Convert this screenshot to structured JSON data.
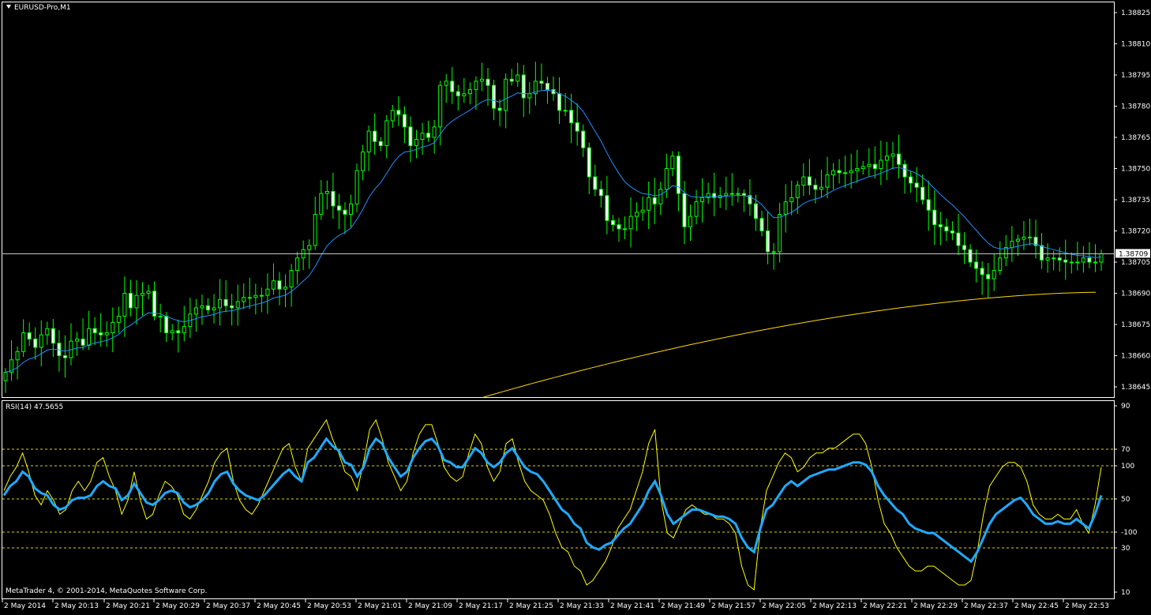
{
  "header": {
    "symbol_label": "EURUSD-Pro,M1"
  },
  "footer": {
    "copyright": "MetaTrader 4, © 2001-2014, MetaQuotes Software Corp."
  },
  "rsi_panel": {
    "label": "RSI(14) 47.5655"
  },
  "colors": {
    "background": "#000000",
    "frame": "#ffffff",
    "candle_bull": "#00ff00",
    "candle_bear_fill": "#ffffff",
    "ma_fast": "#1e90ff",
    "ma_slow": "#ffd700",
    "rsi_main": "#1eaaff",
    "rsi_signal": "#ffff00",
    "rsi_levels": "#ffff00",
    "price_line": "#c8c8c8"
  },
  "chart_data": [
    {
      "type": "candlestick",
      "name": "price",
      "y_ticks": [
        "1.38825",
        "1.38810",
        "1.38795",
        "1.38780",
        "1.38765",
        "1.38750",
        "1.38735",
        "1.38720",
        "1.38705",
        "1.38690",
        "1.38675",
        "1.38660",
        "1.38645"
      ],
      "ylim": [
        1.38642,
        1.38828
      ],
      "current_price": "1.38709",
      "x_ticks": [
        "2 May 2014",
        "2 May 20:13",
        "2 May 20:21",
        "2 May 20:29",
        "2 May 20:37",
        "2 May 20:45",
        "2 May 20:53",
        "2 May 21:01",
        "2 May 21:09",
        "2 May 21:17",
        "2 May 21:25",
        "2 May 21:33",
        "2 May 21:41",
        "2 May 21:49",
        "2 May 21:57",
        "2 May 22:05",
        "2 May 22:13",
        "2 May 22:21",
        "2 May 22:29",
        "2 May 22:37",
        "2 May 22:45",
        "2 May 22:53"
      ],
      "close_series": [
        1.38652,
        1.38658,
        1.38662,
        1.38671,
        1.38668,
        1.38664,
        1.3867,
        1.38673,
        1.38666,
        1.3866,
        1.38659,
        1.38667,
        1.38668,
        1.38665,
        1.38673,
        1.38671,
        1.3867,
        1.38671,
        1.38676,
        1.38679,
        1.3869,
        1.38683,
        1.38689,
        1.3869,
        1.38691,
        1.38679,
        1.38679,
        1.38671,
        1.38672,
        1.38671,
        1.38674,
        1.3868,
        1.38683,
        1.38684,
        1.38682,
        1.38683,
        1.38687,
        1.38684,
        1.38683,
        1.38686,
        1.38688,
        1.38688,
        1.38689,
        1.38689,
        1.38692,
        1.38696,
        1.38692,
        1.38693,
        1.38701,
        1.38707,
        1.38711,
        1.38713,
        1.38728,
        1.38738,
        1.38739,
        1.38732,
        1.3873,
        1.38728,
        1.38733,
        1.38749,
        1.38758,
        1.38768,
        1.38763,
        1.38761,
        1.38773,
        1.38778,
        1.38776,
        1.3877,
        1.38761,
        1.38764,
        1.38767,
        1.38765,
        1.3877,
        1.3879,
        1.38792,
        1.38787,
        1.38785,
        1.38786,
        1.38788,
        1.38792,
        1.38793,
        1.3879,
        1.38779,
        1.38778,
        1.38793,
        1.38792,
        1.38795,
        1.38784,
        1.38786,
        1.38792,
        1.38791,
        1.38788,
        1.38786,
        1.38778,
        1.38778,
        1.38772,
        1.38768,
        1.3876,
        1.38746,
        1.3874,
        1.38737,
        1.38725,
        1.38723,
        1.38721,
        1.38721,
        1.38727,
        1.38729,
        1.3873,
        1.38736,
        1.38733,
        1.3874,
        1.3875,
        1.38756,
        1.38738,
        1.38722,
        1.38727,
        1.38734,
        1.38736,
        1.38738,
        1.38736,
        1.38737,
        1.38738,
        1.38738,
        1.38738,
        1.38737,
        1.38733,
        1.38726,
        1.3872,
        1.3871,
        1.3871,
        1.38728,
        1.38734,
        1.38736,
        1.38742,
        1.38746,
        1.38742,
        1.3874,
        1.38741,
        1.38747,
        1.38749,
        1.38748,
        1.38748,
        1.38749,
        1.3875,
        1.38751,
        1.38752,
        1.3875,
        1.38754,
        1.38756,
        1.38757,
        1.38752,
        1.38746,
        1.38743,
        1.38741,
        1.38735,
        1.3873,
        1.38723,
        1.38722,
        1.3872,
        1.38719,
        1.38713,
        1.38711,
        1.38705,
        1.38702,
        1.38699,
        1.38697,
        1.38701,
        1.38707,
        1.38712,
        1.38715,
        1.38716,
        1.38717,
        1.38717,
        1.38713,
        1.38706,
        1.38707,
        1.38707,
        1.38706,
        1.38705,
        1.38705,
        1.38705,
        1.38707,
        1.38705,
        1.38705,
        1.38709
      ],
      "series": [
        {
          "name": "MA fast",
          "color": "#1e90ff"
        },
        {
          "name": "MA slow",
          "color": "#ffd700"
        }
      ]
    },
    {
      "type": "line",
      "name": "RSI",
      "y_ticks": [
        "90",
        "70",
        "100",
        "50",
        "-100",
        "30",
        "10"
      ],
      "levels": [
        70,
        30
      ],
      "series": [
        {
          "name": "RSI main",
          "values": [
            52,
            56,
            58,
            62,
            60,
            55,
            53,
            52,
            48,
            46,
            47,
            50,
            51,
            51,
            52,
            56,
            58,
            56,
            55,
            50,
            52,
            57,
            53,
            49,
            48,
            50,
            53,
            54,
            53,
            49,
            47,
            48,
            50,
            53,
            58,
            61,
            62,
            57,
            54,
            52,
            51,
            50,
            52,
            55,
            58,
            61,
            63,
            60,
            58,
            66,
            68,
            72,
            76,
            73,
            71,
            66,
            65,
            60,
            64,
            72,
            76,
            74,
            68,
            64,
            60,
            62,
            68,
            72,
            75,
            76,
            73,
            67,
            66,
            64,
            64,
            68,
            72,
            70,
            66,
            64,
            66,
            70,
            72,
            68,
            64,
            62,
            61,
            58,
            54,
            50,
            46,
            44,
            40,
            38,
            32,
            30,
            29,
            31,
            32,
            35,
            38,
            40,
            44,
            48,
            54,
            58,
            52,
            44,
            40,
            42,
            44,
            46,
            46,
            45,
            44,
            43,
            43,
            42,
            40,
            34,
            30,
            28,
            38,
            46,
            48,
            52,
            56,
            58,
            56,
            58,
            60,
            61,
            62,
            63,
            63,
            64,
            65,
            66,
            66,
            65,
            62,
            56,
            52,
            49,
            46,
            44,
            40,
            38,
            37,
            36,
            36,
            34,
            32,
            30,
            28,
            26,
            24,
            28,
            34,
            40,
            44,
            46,
            48,
            50,
            51,
            48,
            44,
            42,
            40,
            40,
            41,
            40,
            40,
            42,
            40,
            38,
            44,
            52
          ],
          "color": "#1eaaff"
        },
        {
          "name": "RSI signal",
          "values": [
            54,
            60,
            64,
            70,
            62,
            52,
            48,
            54,
            50,
            44,
            46,
            54,
            58,
            54,
            58,
            66,
            68,
            60,
            54,
            44,
            50,
            62,
            50,
            42,
            44,
            52,
            58,
            56,
            52,
            44,
            42,
            46,
            52,
            58,
            66,
            70,
            72,
            58,
            50,
            46,
            44,
            48,
            54,
            60,
            66,
            72,
            74,
            64,
            58,
            72,
            76,
            80,
            84,
            76,
            70,
            62,
            60,
            54,
            66,
            80,
            84,
            76,
            66,
            60,
            54,
            58,
            70,
            78,
            82,
            82,
            74,
            64,
            60,
            58,
            60,
            70,
            78,
            74,
            64,
            58,
            62,
            74,
            76,
            66,
            58,
            54,
            52,
            50,
            44,
            36,
            30,
            28,
            22,
            20,
            14,
            16,
            20,
            24,
            30,
            38,
            42,
            46,
            54,
            62,
            74,
            80,
            50,
            36,
            34,
            40,
            46,
            48,
            46,
            44,
            44,
            42,
            42,
            40,
            36,
            22,
            14,
            12,
            38,
            54,
            60,
            66,
            70,
            68,
            62,
            64,
            68,
            70,
            70,
            72,
            72,
            74,
            76,
            78,
            78,
            74,
            64,
            50,
            40,
            36,
            30,
            26,
            22,
            20,
            20,
            22,
            22,
            20,
            18,
            16,
            14,
            14,
            16,
            28,
            44,
            56,
            60,
            64,
            66,
            66,
            64,
            58,
            48,
            44,
            42,
            42,
            44,
            42,
            42,
            46,
            40,
            36,
            48,
            64
          ],
          "color": "#ffff00"
        }
      ]
    }
  ]
}
